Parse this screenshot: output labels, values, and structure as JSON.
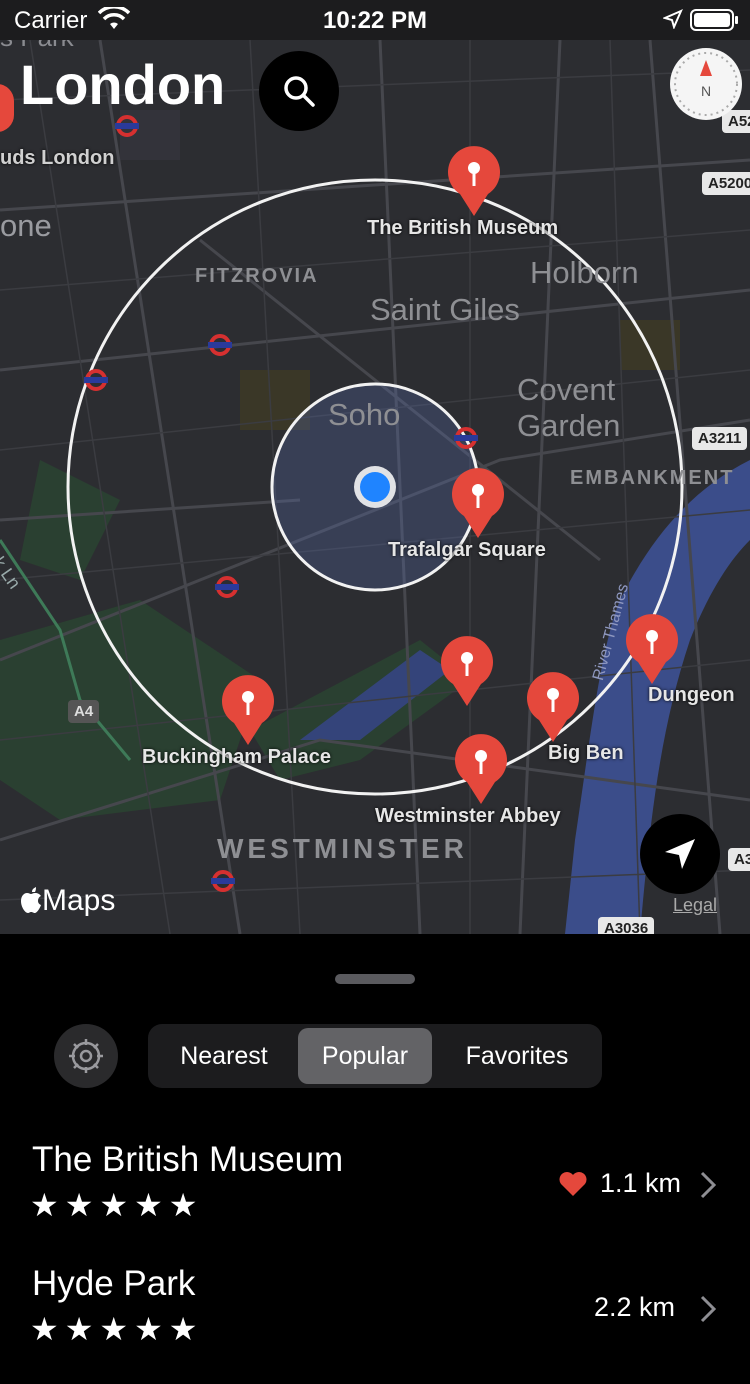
{
  "status_bar": {
    "carrier": "Carrier",
    "time": "10:22 PM"
  },
  "map": {
    "city_title": "London",
    "areas": [
      {
        "text": "Saint Giles"
      },
      {
        "text": "Holborn"
      },
      {
        "text": "Soho"
      },
      {
        "text": "Covent"
      },
      {
        "text": "Garden"
      },
      {
        "text": "FITZROVIA"
      },
      {
        "text": "EMBANKMENT"
      },
      {
        "text": "WESTMINSTER"
      },
      {
        "text": "one"
      },
      {
        "text": "s Park"
      },
      {
        "text": "uds London"
      },
      {
        "text": "ark Ln"
      },
      {
        "text": "River Thames"
      }
    ],
    "roads": [
      "A52",
      "A5200",
      "A3211",
      "A4",
      "A3036",
      "A3"
    ],
    "pois": [
      {
        "label": "The British Museum"
      },
      {
        "label": "Trafalgar Square"
      },
      {
        "label": "Buckingham Palace"
      },
      {
        "label": "Westminster Abbey"
      },
      {
        "label": "Big Ben"
      },
      {
        "label": "Dungeon"
      }
    ],
    "maps_logo": "Maps",
    "legal": "Legal",
    "compass_letter": "N"
  },
  "sheet": {
    "tabs": [
      {
        "label": "Nearest",
        "active": false
      },
      {
        "label": "Popular",
        "active": true
      },
      {
        "label": "Favorites",
        "active": false
      }
    ],
    "places": [
      {
        "name": "The British Museum",
        "rating": 4.5,
        "stars": "★★★★★",
        "distance": "1.1 km",
        "favorite": true
      },
      {
        "name": "Hyde Park",
        "rating": 4.5,
        "stars": "★★★★★",
        "distance": "2.2 km",
        "favorite": false
      }
    ]
  },
  "colors": {
    "pin": "#e5483c",
    "user_dot": "#1f84ff",
    "map_bg": "#2c2d31",
    "river": "#3b4d8a",
    "park": "#2a4031"
  }
}
